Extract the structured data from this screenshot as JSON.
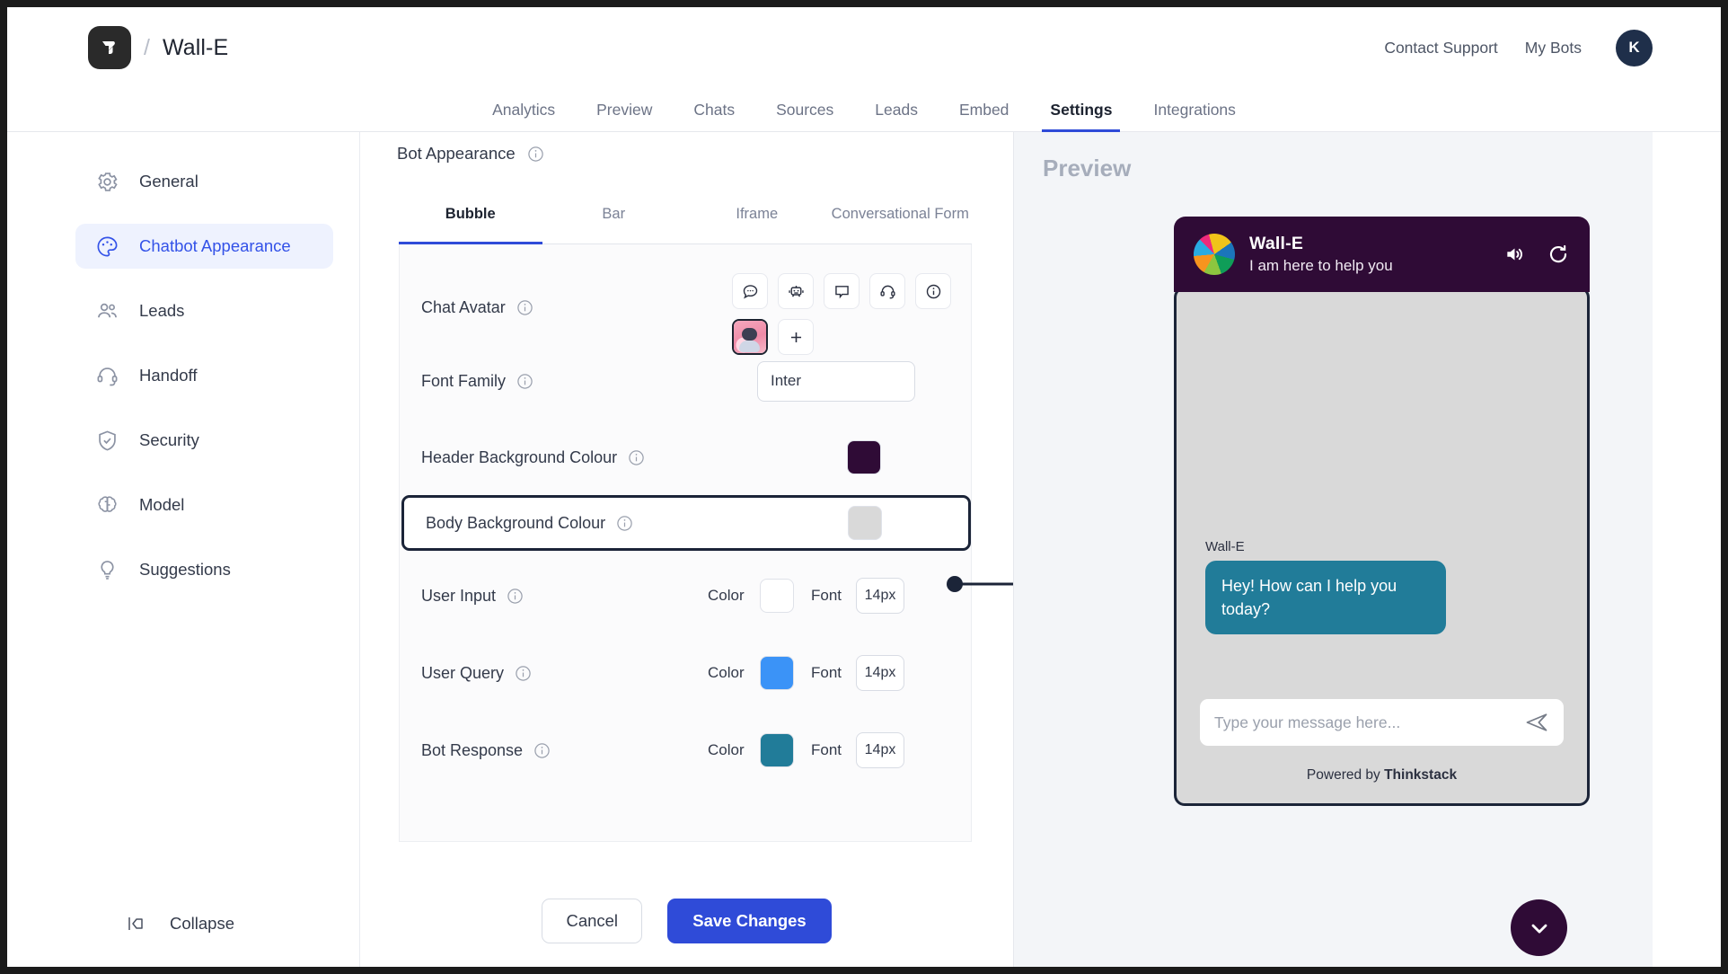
{
  "header": {
    "brand_name": "Wall-E",
    "separator": "/",
    "logo_icon": "thinkstack-logo-icon",
    "contact_support": "Contact Support",
    "my_bots": "My Bots",
    "user_initial": "K"
  },
  "nav": {
    "tabs": [
      {
        "label": "Analytics",
        "active": false
      },
      {
        "label": "Preview",
        "active": false
      },
      {
        "label": "Chats",
        "active": false
      },
      {
        "label": "Sources",
        "active": false
      },
      {
        "label": "Leads",
        "active": false
      },
      {
        "label": "Embed",
        "active": false
      },
      {
        "label": "Settings",
        "active": true
      },
      {
        "label": "Integrations",
        "active": false
      }
    ]
  },
  "sidebar": {
    "items": [
      {
        "label": "General",
        "icon": "gear-icon",
        "active": false
      },
      {
        "label": "Chatbot Appearance",
        "icon": "palette-icon",
        "active": true
      },
      {
        "label": "Leads",
        "icon": "users-icon",
        "active": false
      },
      {
        "label": "Handoff",
        "icon": "headset-icon",
        "active": false
      },
      {
        "label": "Security",
        "icon": "shield-check-icon",
        "active": false
      },
      {
        "label": "Model",
        "icon": "brain-icon",
        "active": false
      },
      {
        "label": "Suggestions",
        "icon": "lightbulb-icon",
        "active": false
      }
    ],
    "collapse_label": "Collapse",
    "collapse_icon": "collapse-arrow-icon"
  },
  "main": {
    "section_title": "Bot Appearance",
    "section_info_icon": "info-icon",
    "tabs": [
      {
        "label": "Bubble",
        "active": true
      },
      {
        "label": "Bar",
        "active": false
      },
      {
        "label": "Iframe",
        "active": false
      },
      {
        "label": "Conversational Form",
        "active": false
      }
    ],
    "rows": {
      "chat_avatar": {
        "label": "Chat Avatar",
        "options": [
          "chat-bubble-avatar-icon",
          "robot-avatar-icon",
          "speech-box-avatar-icon",
          "headset-avatar-icon",
          "info-avatar-icon",
          "pink-robot-avatar-image"
        ],
        "selected_index": 5,
        "add_label": "+"
      },
      "font_family": {
        "label": "Font Family",
        "value": "Inter"
      },
      "header_background_colour": {
        "label": "Header Background Colour",
        "color": "#2f0b36"
      },
      "body_background_colour": {
        "label": "Body Background Colour",
        "color": "#d9d9d9",
        "highlighted": true
      },
      "user_input": {
        "label": "User Input",
        "color_label": "Color",
        "color": "#ffffff",
        "font_label": "Font",
        "font_size": "14px"
      },
      "user_query": {
        "label": "User Query",
        "color_label": "Color",
        "color": "#3b93f7",
        "font_label": "Font",
        "font_size": "14px"
      },
      "bot_response": {
        "label": "Bot Response",
        "color_label": "Color",
        "color": "#217c99",
        "font_label": "Font",
        "font_size": "14px"
      }
    },
    "cancel_label": "Cancel",
    "save_label": "Save Changes"
  },
  "preview": {
    "title": "Preview",
    "widget": {
      "bot_name": "Wall-E",
      "tagline": "I am here to help you",
      "logo_icon": "pinwheel-logo-icon",
      "sound_icon": "speaker-icon",
      "refresh_icon": "refresh-icon",
      "message_sender": "Wall-E",
      "message_text": "Hey! How can I help you today?",
      "input_placeholder": "Type your message here...",
      "send_icon": "send-icon",
      "footer_prefix": "Powered by ",
      "footer_brand": "Thinkstack",
      "header_bg": "#2f0b36",
      "body_bg": "#d9d9d9",
      "bubble_bg": "#217c99"
    },
    "fab_icon": "chevron-down-icon"
  }
}
